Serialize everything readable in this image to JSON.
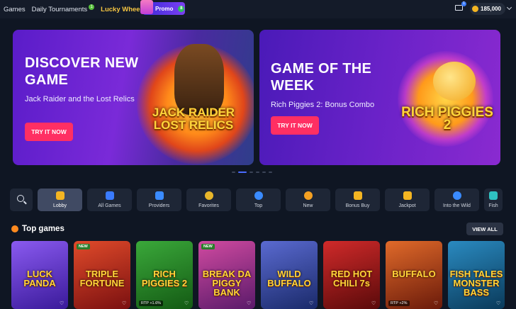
{
  "nav": {
    "games": "Games",
    "tournaments": "Daily Tournaments",
    "tournaments_badge": "1",
    "lucky": "Lucky Wheel",
    "promo": "Promo",
    "promo_badge": "8"
  },
  "header": {
    "mail_badge": "1",
    "balance": "185,000"
  },
  "banners": [
    {
      "title": "DISCOVER NEW GAME",
      "subtitle": "Jack Raider and the Lost Relics",
      "cta": "TRY IT NOW",
      "logo": "JACK RAIDER LOST RELICS"
    },
    {
      "title": "GAME OF THE WEEK",
      "subtitle": "Rich Piggies 2: Bonus Combo",
      "cta": "TRY IT NOW",
      "logo": "RICH PIGGIES 2"
    }
  ],
  "categories": [
    {
      "label": "Lobby",
      "icon": "lobby-icon"
    },
    {
      "label": "All Games",
      "icon": "gamepad-icon"
    },
    {
      "label": "Providers",
      "icon": "providers-icon"
    },
    {
      "label": "Favorites",
      "icon": "favorites-icon"
    },
    {
      "label": "Top",
      "icon": "target-icon"
    },
    {
      "label": "New",
      "icon": "new-icon"
    },
    {
      "label": "Bonus Buy",
      "icon": "gift-icon"
    },
    {
      "label": "Jackpot",
      "icon": "trophy-icon"
    },
    {
      "label": "Into the Wild",
      "icon": "paw-icon"
    },
    {
      "label": "Fish",
      "icon": "fish-icon"
    }
  ],
  "section": {
    "title": "Top games",
    "view_all": "VIEW ALL"
  },
  "games": [
    {
      "name": "LUCK PANDA",
      "tag": "",
      "rtp": "",
      "color": "#6a3bd6"
    },
    {
      "name": "TRIPLE FORTUNE",
      "tag": "NEW",
      "rtp": "",
      "color": "#c8321e"
    },
    {
      "name": "RICH PIGGIES 2",
      "tag": "",
      "rtp": "RTP +1.6%",
      "color": "#2c8a2a"
    },
    {
      "name": "BREAK DA PIGGY BANK",
      "tag": "NEW",
      "rtp": "",
      "color": "#b0368a"
    },
    {
      "name": "WILD BUFFALO",
      "tag": "",
      "rtp": "",
      "color": "#3a4fb0"
    },
    {
      "name": "RED HOT CHILI 7s",
      "tag": "",
      "rtp": "",
      "color": "#b01a1a"
    },
    {
      "name": "BUFFALO",
      "tag": "",
      "rtp": "RTP +2%",
      "color": "#c8501a"
    },
    {
      "name": "FISH TALES MONSTER BASS",
      "tag": "",
      "rtp": "",
      "color": "#1a6a9a"
    }
  ]
}
